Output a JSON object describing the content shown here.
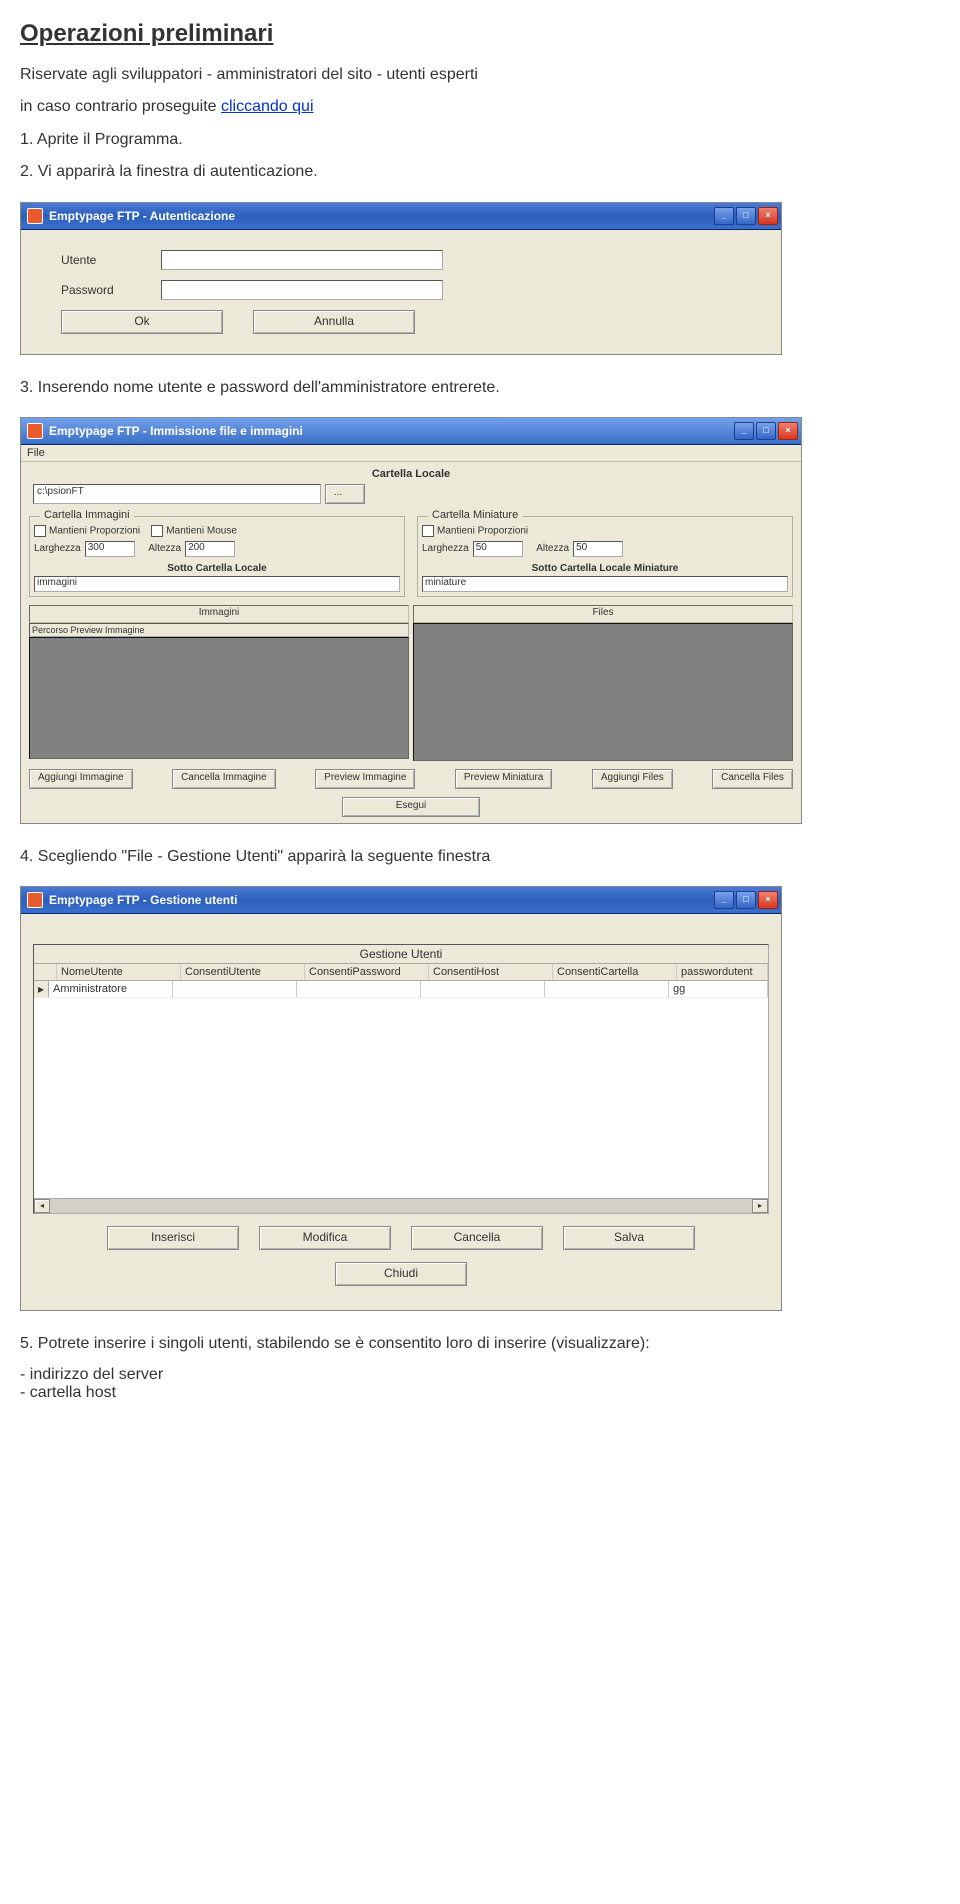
{
  "heading": "Operazioni preliminari",
  "intro1": "Riservate agli sviluppatori - amministratori del sito - utenti esperti",
  "intro2a": "in caso contrario proseguite ",
  "intro2_link": "cliccando qui",
  "step1": "1. Aprite il Programma.",
  "step2": "2. Vi apparirà la finestra di autenticazione.",
  "step3": "3. Inserendo nome utente e password dell'amministratore entrerete.",
  "step4": "4. Scegliendo \"File - Gestione Utenti\" apparirà la seguente finestra",
  "step5": "5. Potrete inserire i singoli utenti, stabilendo se è consentito loro di inserire (visualizzare):",
  "bullet1": "- indirizzo del server",
  "bullet2": "- cartella host",
  "win1": {
    "title": "Emptypage FTP - Autenticazione",
    "label_user": "Utente",
    "label_pass": "Password",
    "btn_ok": "Ok",
    "btn_cancel": "Annulla"
  },
  "win2": {
    "title": "Emptypage FTP - Immissione file e immagini",
    "menu_file": "File",
    "cartella_locale": "Cartella Locale",
    "path": "c:\\psionFT",
    "cartella_immagini": "Cartella Immagini",
    "cartella_miniature": "Cartella Miniature",
    "mantieni_prop": "Mantieni Proporzioni",
    "mantieni_mouse": "Mantieni Mouse",
    "larghezza": "Larghezza",
    "altezza": "Altezza",
    "val_larg_img": "300",
    "val_alt_img": "200",
    "val_larg_min": "50",
    "val_alt_min": "50",
    "sotto_cartella_locale": "Sotto Cartella Locale",
    "sotto_cartella_locale_min": "Sotto Cartella Locale Miniature",
    "immagini_folder": "immagini",
    "miniature_folder": "miniature",
    "tab_immagini": "Immagini",
    "tab_files": "Files",
    "percorso_preview": "Percorso  Preview Immagine",
    "btn_agg_img": "Aggiungi Immagine",
    "btn_canc_img": "Cancella Immagine",
    "btn_prev_img": "Preview Immagine",
    "btn_prev_min": "Preview Miniatura",
    "btn_agg_files": "Aggiungi Files",
    "btn_canc_files": "Cancella Files",
    "btn_esegui": "Esegui"
  },
  "win3": {
    "title": "Emptypage FTP - Gestione utenti",
    "grid_title": "Gestione Utenti",
    "columns": [
      "NomeUtente",
      "ConsentiUtente",
      "ConsentiPassword",
      "ConsentiHost",
      "ConsentiCartella",
      "passwordutent"
    ],
    "row1": {
      "nome": "Amministratore",
      "pw": "gg"
    },
    "btn_inserisci": "Inserisci",
    "btn_modifica": "Modifica",
    "btn_cancella": "Cancella",
    "btn_salva": "Salva",
    "btn_chiudi": "Chiudi"
  }
}
